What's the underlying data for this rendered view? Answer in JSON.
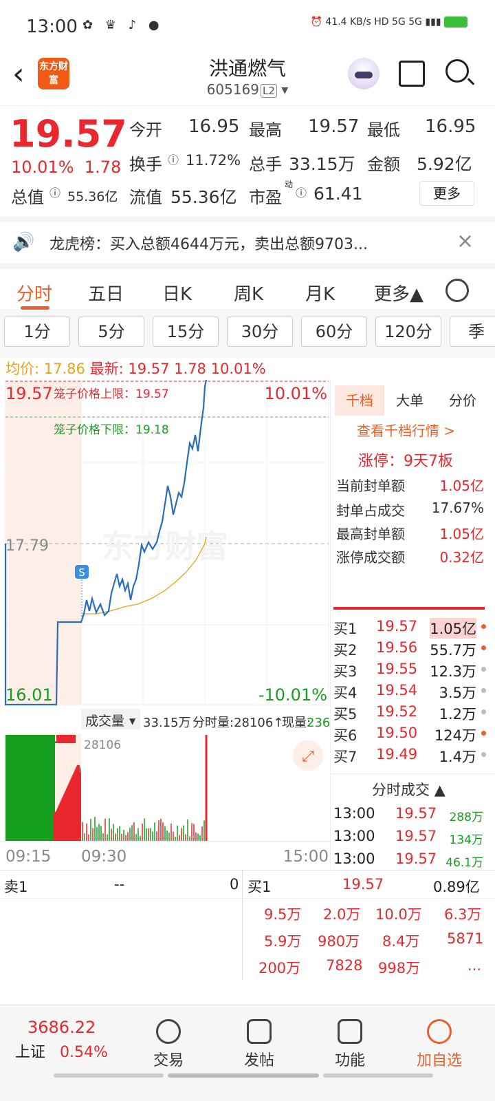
{
  "status": {
    "time": "13:00",
    "net": "41.4 KB/s",
    "signal": "HD 5G 5G"
  },
  "header": {
    "title": "洪通燃气",
    "code": "605169",
    "level": "L2",
    "logo": "东方财富"
  },
  "quote": {
    "price": "19.57",
    "pct": "10.01%",
    "chg": "1.78",
    "open_l": "今开",
    "open": "16.95",
    "high_l": "最高",
    "high": "19.57",
    "low_l": "最低",
    "low": "16.95",
    "turn_l": "换手",
    "turn": "11.72%",
    "vol_l": "总手",
    "vol": "33.15万",
    "amt_l": "金额",
    "amt": "5.92亿",
    "mcap_l": "总值",
    "mcap": "55.36亿",
    "fmcap_l": "流值",
    "fmcap": "55.36亿",
    "pe_l": "市盈",
    "pe_sup": "动",
    "pe": "61.41",
    "more": "更多"
  },
  "notice": "龙虎榜：买入总额4644万元，卖出总额9703...",
  "tabs": [
    "分时",
    "五日",
    "日K",
    "周K",
    "月K",
    "更多▲"
  ],
  "periods": [
    "1分",
    "5分",
    "15分",
    "30分",
    "60分",
    "120分",
    "季"
  ],
  "avg": {
    "avg_l": "均价:",
    "avg": "17.86",
    "last_l": "最新:",
    "last": "19.57",
    "chg": "1.78",
    "pct": "10.01%"
  },
  "chart": {
    "ymax": "19.57",
    "ymid": "17.79",
    "ymin": "16.01",
    "pmax": "10.01%",
    "pmin": "-10.01%",
    "cage_up": "笼子价格上限：19.57",
    "cage_dn": "笼子价格下限：19.18",
    "watermark": "东方财富",
    "s": "S",
    "vol_label": "成交量",
    "vol_total": "33.15万",
    "vol_min": "分时量:28106↑",
    "vol_now_l": "现量:",
    "vol_now": "236",
    "vol_peak": "28106",
    "t0": "09:15",
    "t1": "09:30",
    "t2": "15:00"
  },
  "side": {
    "tabs": [
      "千档",
      "大单",
      "分价"
    ],
    "link": "查看千档行情 >",
    "limit": "涨停：9天7板",
    "kv": [
      [
        "当前封单额",
        "1.05亿"
      ],
      [
        "封单占成交",
        "17.67%"
      ],
      [
        "最高封单额",
        "1.05亿"
      ],
      [
        "涨停成交额",
        "0.32亿"
      ]
    ],
    "bids": [
      [
        "买1",
        "19.57",
        "1.05亿"
      ],
      [
        "买2",
        "19.56",
        "55.7万"
      ],
      [
        "买3",
        "19.55",
        "12.3万"
      ],
      [
        "买4",
        "19.54",
        "3.5万"
      ],
      [
        "买5",
        "19.52",
        "1.2万"
      ],
      [
        "买6",
        "19.50",
        "124万"
      ],
      [
        "买7",
        "19.49",
        "1.4万"
      ]
    ],
    "trades_title": "分时成交 ▲",
    "trades": [
      [
        "13:00",
        "19.57",
        "288万"
      ],
      [
        "13:00",
        "19.57",
        "134万"
      ],
      [
        "13:00",
        "19.57",
        "46.1万"
      ]
    ]
  },
  "bottom": {
    "ask_l": "卖1",
    "ask_p": "--",
    "ask_v": "0",
    "bid_l": "买1",
    "bid_p": "19.57",
    "bid_v": "0.89亿",
    "rows": [
      [
        "9.5万",
        "2.0万",
        "10.0万",
        "6.3万"
      ],
      [
        "5.9万",
        "980万",
        "8.4万",
        "5871"
      ],
      [
        "200万",
        "7828",
        "998万",
        "..."
      ]
    ]
  },
  "nav": {
    "index": "3686.22",
    "index_name": "上证",
    "index_pct": "0.54%",
    "items": [
      "交易",
      "发帖",
      "功能",
      "加自选"
    ]
  }
}
